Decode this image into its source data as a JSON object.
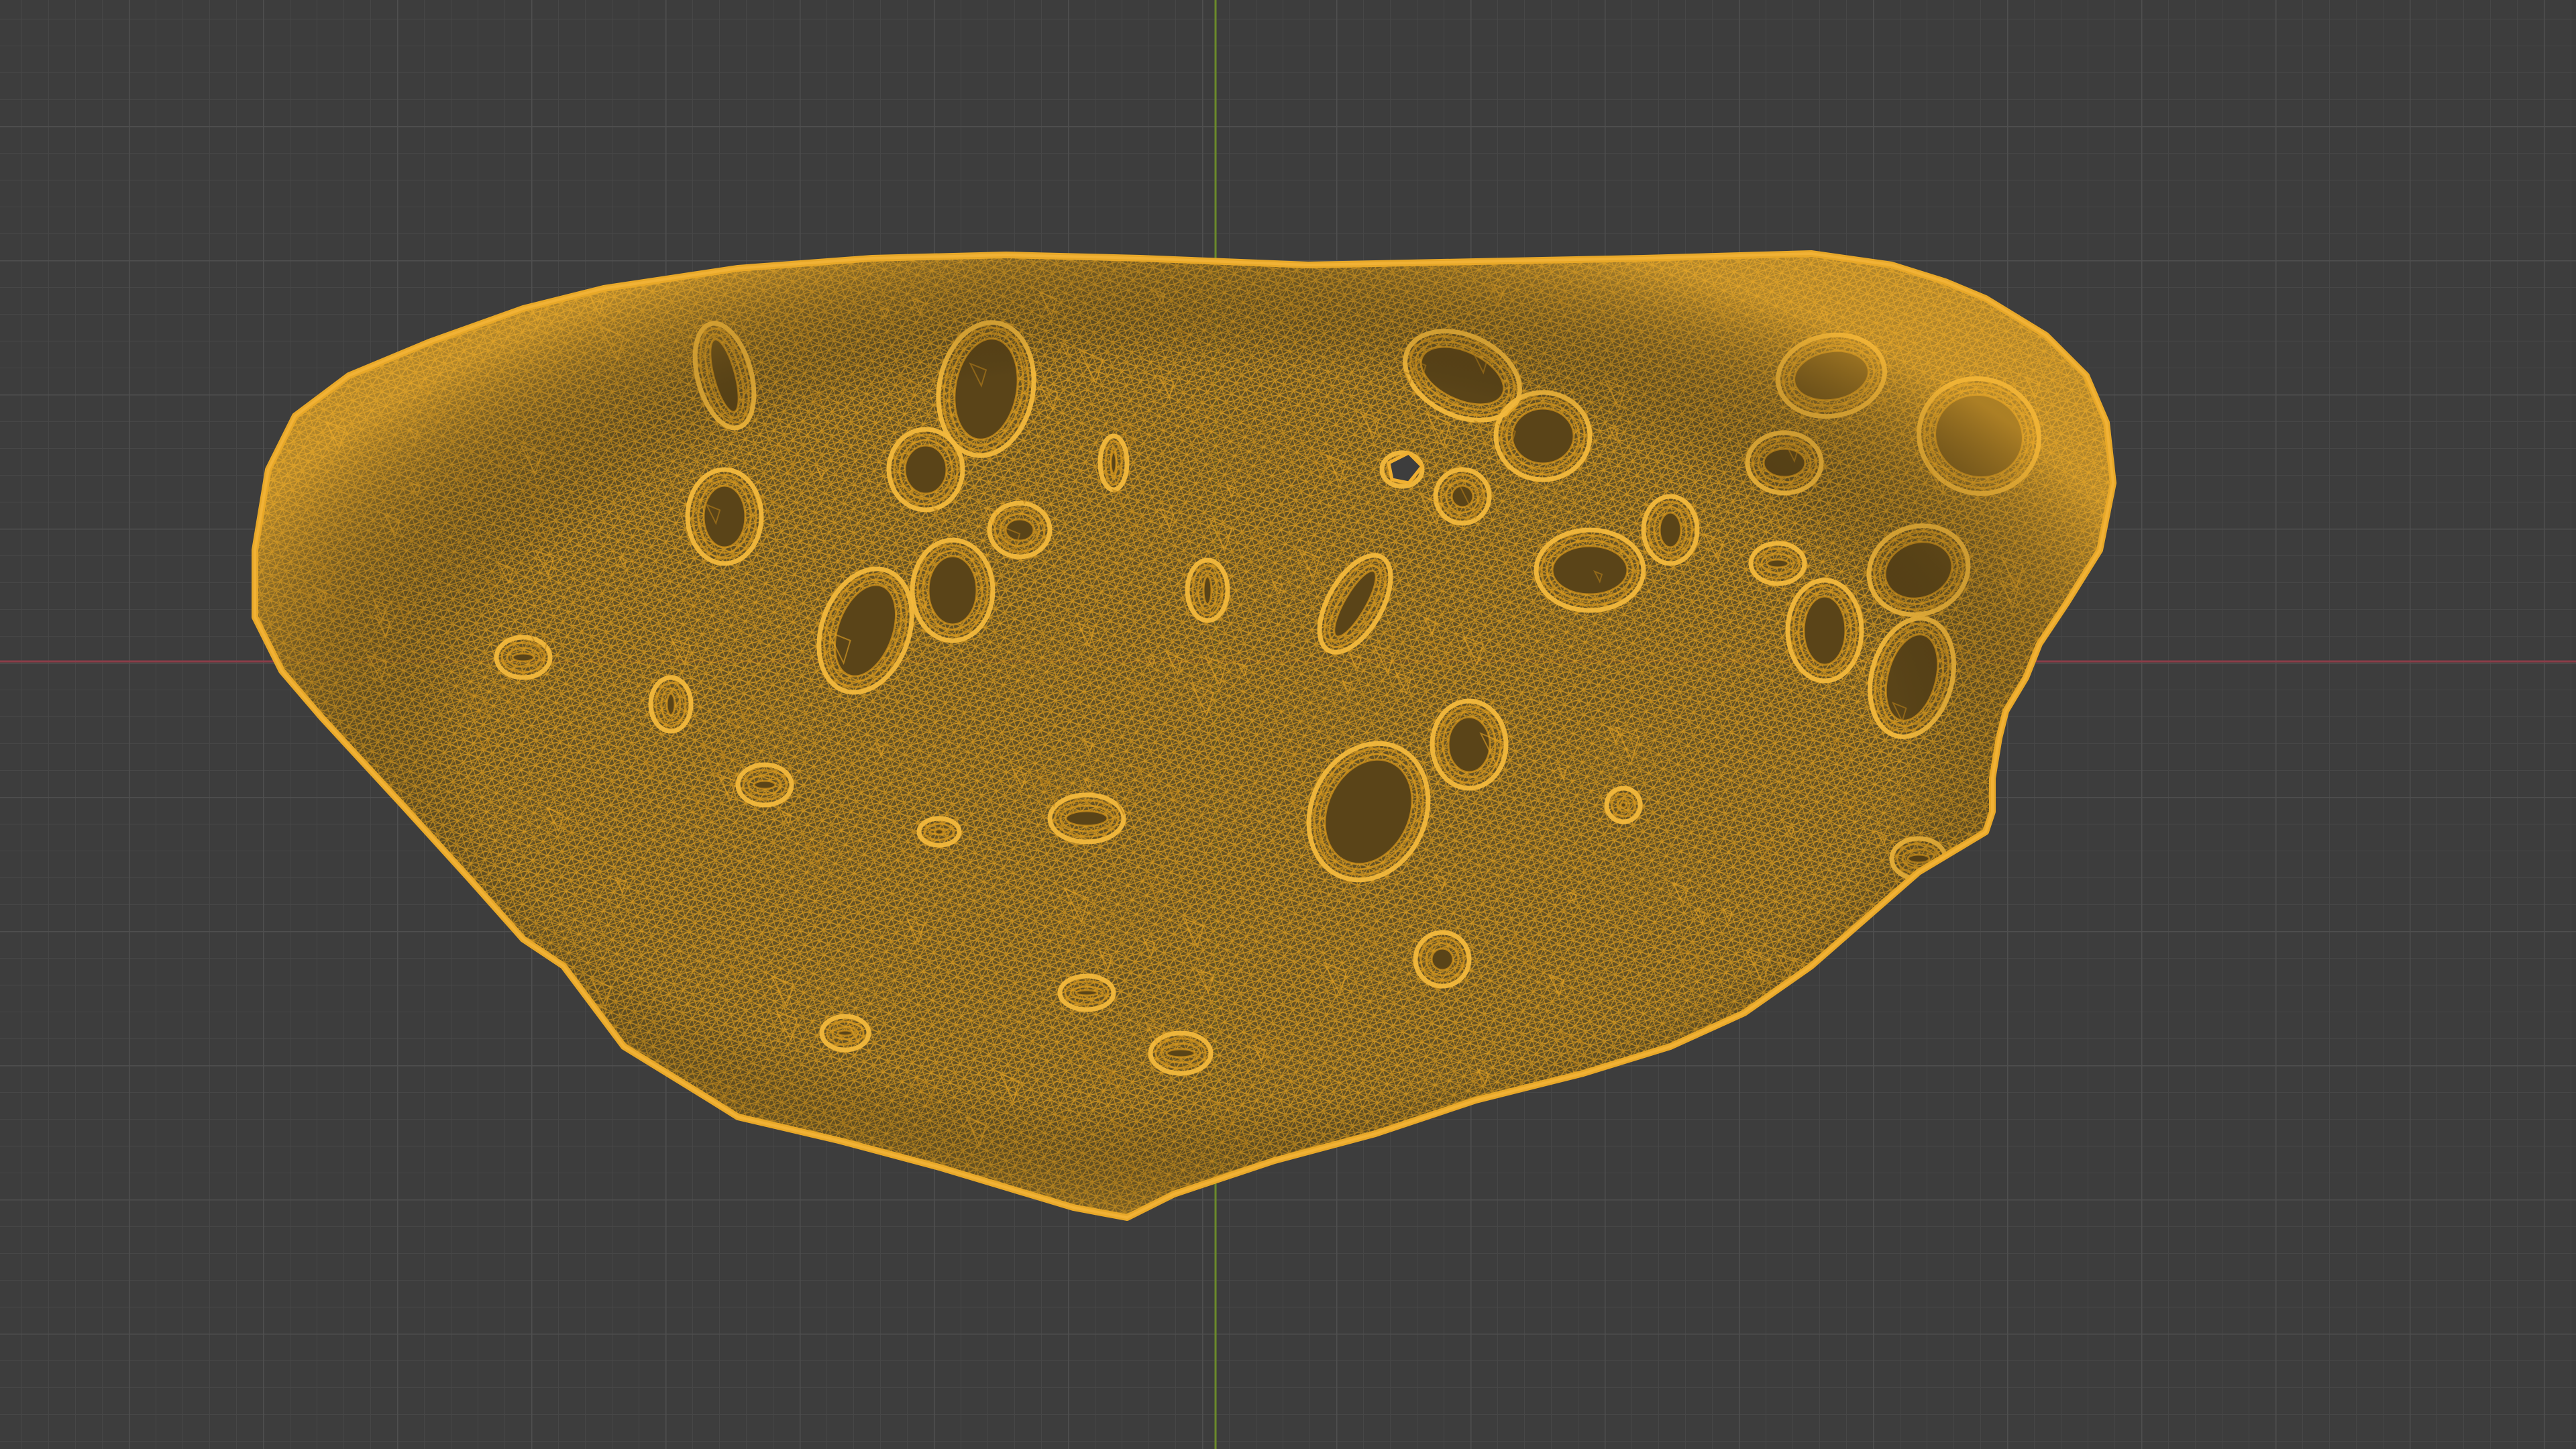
{
  "viewport": {
    "view_type": "3d-viewport-wireframe",
    "background_color": "#3d3d3d",
    "grid": true,
    "grid_minor_color": "#474747",
    "grid_major_color": "#4f4f4f",
    "x_axis_color": "#8a3d48",
    "y_axis_color": "#6b8a2a",
    "mesh_wire_color": "#e0a020",
    "mesh_wire_dark_color": "#8a5c10",
    "mesh_fill_color": "#6b5520",
    "mesh_name": "",
    "overlay_text": ""
  }
}
